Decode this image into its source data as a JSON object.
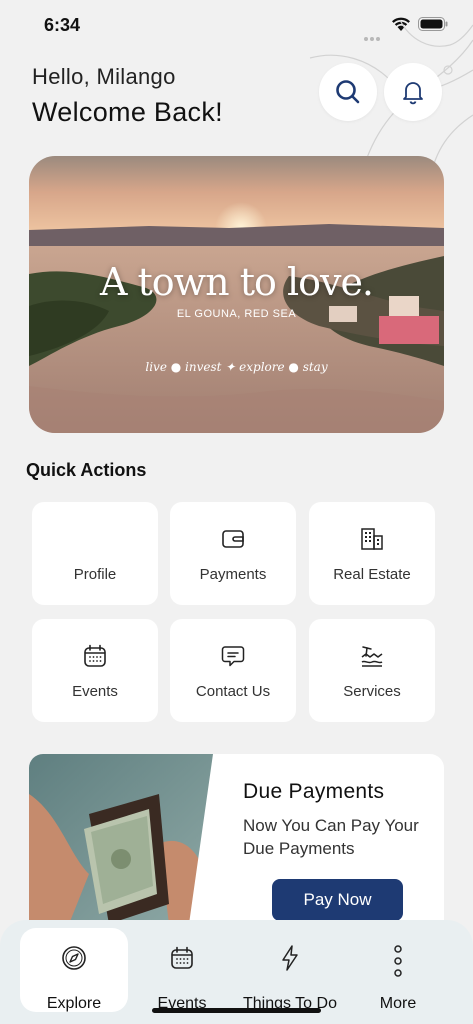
{
  "status": {
    "time": "6:34"
  },
  "header": {
    "greeting": "Hello, Milango",
    "welcome": "Welcome Back!",
    "search_icon": "search-icon",
    "bell_icon": "bell-icon"
  },
  "hero": {
    "title": "A town to love.",
    "subtitle": "EL GOUNA, RED SEA",
    "tagline": "live ● invest ✦ explore ● stay"
  },
  "quick_actions": {
    "title": "Quick Actions",
    "items": [
      {
        "label": "Profile",
        "icon": ""
      },
      {
        "label": "Payments",
        "icon": "wallet-icon"
      },
      {
        "label": "Real Estate",
        "icon": "building-icon"
      },
      {
        "label": "Events",
        "icon": "calendar-icon"
      },
      {
        "label": "Contact Us",
        "icon": "chat-icon"
      },
      {
        "label": "Services",
        "icon": "beach-icon"
      }
    ]
  },
  "promo": {
    "title": "Due Payments",
    "description": "Now You Can Pay Your Due Payments",
    "button": "Pay Now",
    "button_color": "#1e3a73"
  },
  "bottom_nav": {
    "items": [
      {
        "label": "Explore",
        "icon": "compass-icon",
        "active": true
      },
      {
        "label": "Events",
        "icon": "calendar-icon",
        "active": false
      },
      {
        "label": "Things To Do",
        "icon": "lightning-icon",
        "active": false
      },
      {
        "label": "More",
        "icon": "more-vertical-icon",
        "active": false
      }
    ]
  }
}
